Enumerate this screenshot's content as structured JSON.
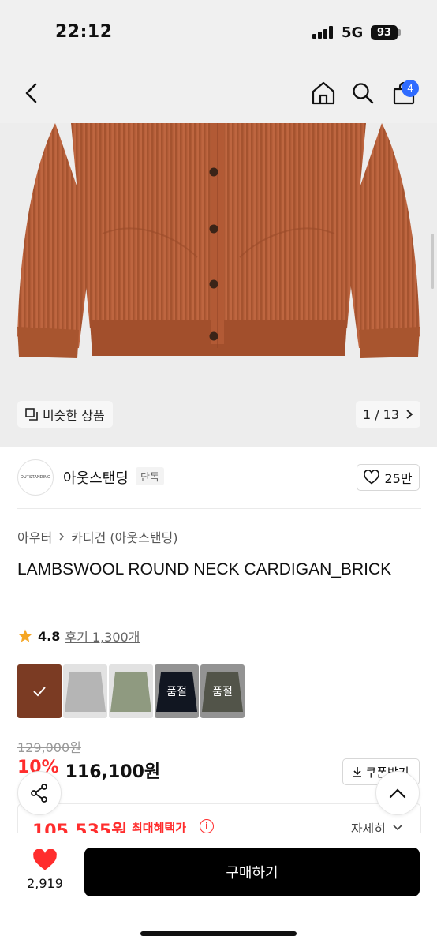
{
  "status_bar": {
    "time": "22:12",
    "network": "5G",
    "battery": "93"
  },
  "nav": {
    "cart_count": "4"
  },
  "gallery": {
    "similar_label": "비슷한 상품",
    "page_indicator": "1 / 13"
  },
  "brand": {
    "logo_text": "OUTSTANDING",
    "name": "아웃스탠딩",
    "tag": "단독",
    "likes": "25만"
  },
  "product": {
    "breadcrumb": [
      "아우터",
      "카디건 (아웃스탠딩)"
    ],
    "title": "LAMBSWOOL ROUND NECK CARDIGAN_BRICK",
    "rating": "4.8",
    "reviews": "후기 1,300개"
  },
  "colors": {
    "brand_accent": "#ff2d2d",
    "badge": "#2f6bff"
  },
  "swatches": [
    {
      "name": "brick",
      "color": "#9a4a2c",
      "selected": true,
      "label": ""
    },
    {
      "name": "grey",
      "color": "#b5b5b5",
      "selected": false,
      "label": ""
    },
    {
      "name": "sage",
      "color": "#8f9a80",
      "selected": false,
      "label": ""
    },
    {
      "name": "navy",
      "color": "#1b2233",
      "selected": false,
      "label": "품절"
    },
    {
      "name": "olive-grey",
      "color": "#7e8270",
      "selected": false,
      "label": "품절"
    }
  ],
  "pricing": {
    "original": "129,000원",
    "discount": "10%",
    "price": "116,100원",
    "coupon_label": "쿠폰받기",
    "benefit_price": "105,535원",
    "benefit_label": "최대혜택가",
    "detail_label": "자세히"
  },
  "bottom": {
    "wish_count": "2,919",
    "buy_label": "구매하기"
  }
}
